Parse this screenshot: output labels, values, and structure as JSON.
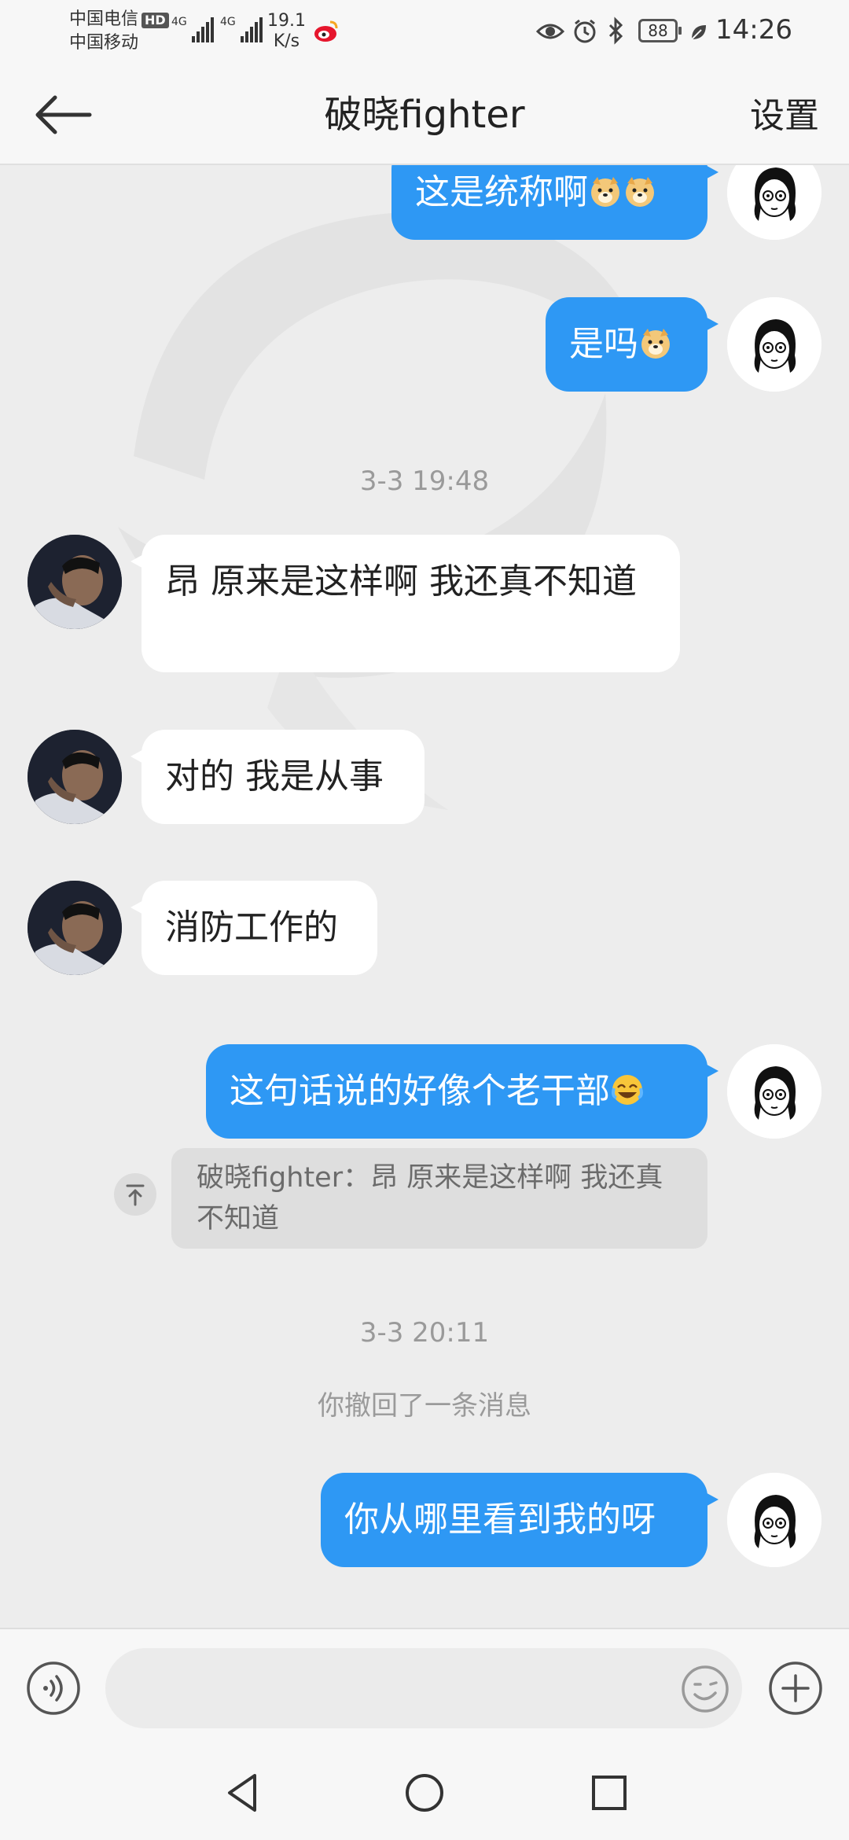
{
  "status_bar": {
    "carrier1": "中国电信",
    "hd_badge": "HD",
    "carrier2": "中国移动",
    "signal1": "4G",
    "signal2": "4G",
    "speed_value": "19.1",
    "speed_unit": "K/s",
    "battery": "88",
    "time": "14:26"
  },
  "header": {
    "title": "破晓fighter",
    "settings_label": "设置"
  },
  "messages": {
    "m1": "这是统称啊",
    "m2": "是吗",
    "ts1": "3-3 19:48",
    "m3": "昂 原来是这样啊 我还真不知道",
    "m4": "对的 我是从事",
    "m5": "消防工作的",
    "m6": "这句话说的好像个老干部",
    "quote": "破晓fighter：昂 原来是这样啊 我还真不知道",
    "ts2": "3-3 20:11",
    "recall": "你撤回了一条消息",
    "m7": "你从哪里看到我的呀"
  },
  "input": {
    "value": "",
    "placeholder": ""
  },
  "colors": {
    "outgoing_bubble": "#2e98f4",
    "incoming_bubble": "#ffffff",
    "chat_background": "#ededed"
  },
  "icons": [
    "back-arrow-icon",
    "voice-icon",
    "emoji-icon",
    "plus-icon",
    "nav-back-icon",
    "nav-home-icon",
    "nav-recent-icon",
    "doge-emoji-icon",
    "laugh-emoji-icon",
    "eye-icon",
    "alarm-icon",
    "bluetooth-icon",
    "leaf-icon",
    "weibo-icon"
  ]
}
